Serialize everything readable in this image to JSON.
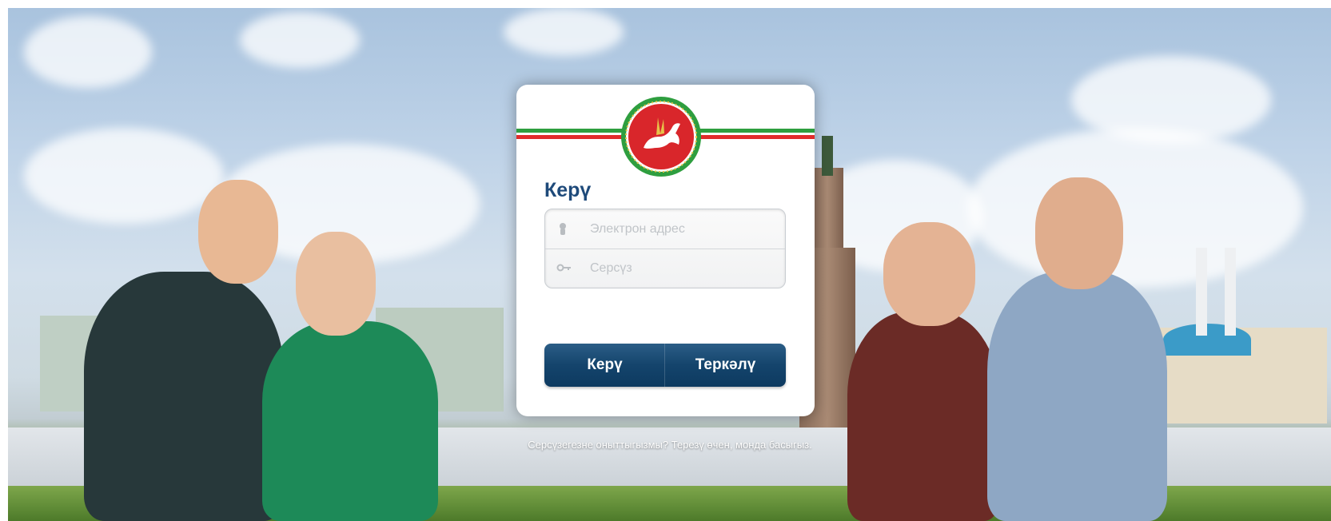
{
  "login_form": {
    "title": "Керү",
    "email_placeholder": "Электрон адрес",
    "password_placeholder": "Серсүз",
    "login_button": "Керү",
    "register_button": "Теркәлү"
  },
  "forgot_password_text": "Серсүзегезне оныттыгызмы? Терезү өчен, монда басыгыз.",
  "colors": {
    "title": "#1e4a7a",
    "button": "#14446c",
    "flag_green": "#2e9e3f",
    "flag_red": "#e02b2b"
  },
  "icons": {
    "email": "user-icon",
    "password": "key-icon",
    "emblem": "coat-of-arms-emblem"
  }
}
